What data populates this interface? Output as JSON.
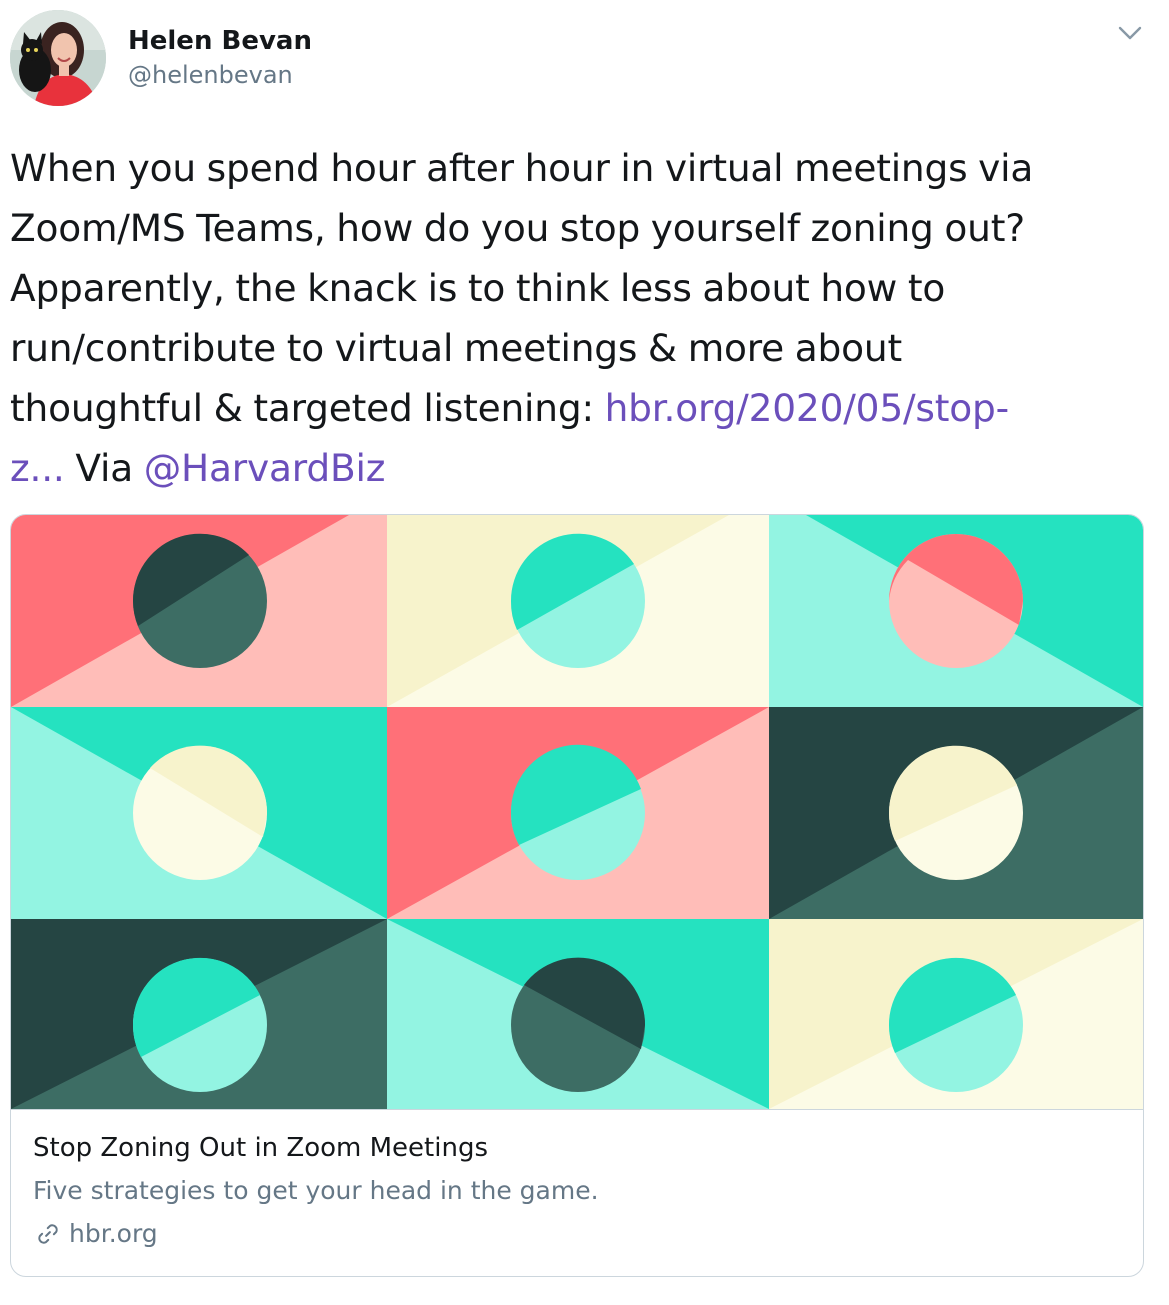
{
  "author": {
    "name": "Helen Bevan",
    "handle": "@helenbevan",
    "avatar_icon": "profile-photo"
  },
  "menu": {
    "icon": "chevron-down-icon"
  },
  "tweet": {
    "line1": "When you spend hour after hour in virtual meetings via",
    "line2": "Zoom/MS Teams, how do you stop yourself zoning out?",
    "line3": "Apparently, the knack is to think less about how to",
    "line4": "run/contribute to virtual meetings & more about",
    "line5_text": "thoughtful & targeted listening: ",
    "link_part1": "hbr.org/2020/05/stop-",
    "link_part2": "z...",
    "via_text": " Via ",
    "mention": "@HarvardBiz",
    "link_color": "#6b4fbb"
  },
  "card": {
    "title": "Stop Zoning Out in Zoom Meetings",
    "description": "Five strategies to get your head in the game.",
    "domain": "hbr.org",
    "domain_icon": "link-icon"
  },
  "colors": {
    "coral": "#ff7078",
    "pink": "#ffbdb8",
    "cream": "#f7f3cc",
    "cream_light": "#fcfbe6",
    "teal": "#25e2c0",
    "mint": "#93f4e2",
    "dark": "#254543",
    "dark_mid": "#3d6d64",
    "text": "#14171a",
    "muted": "#657786",
    "border": "#ccd6dd"
  }
}
